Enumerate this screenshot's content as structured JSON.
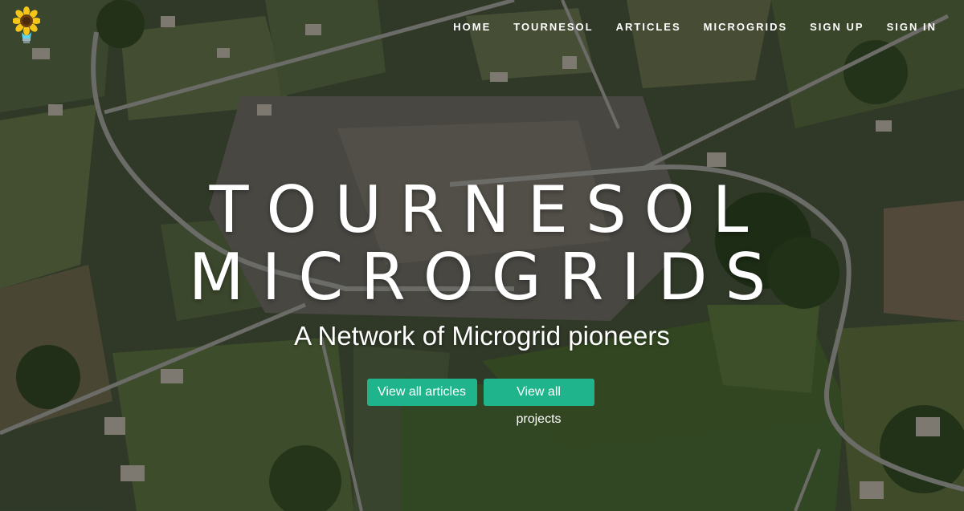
{
  "nav": {
    "items": [
      {
        "label": "HOME"
      },
      {
        "label": "TOURNESOL"
      },
      {
        "label": "ARTICLES"
      },
      {
        "label": "MICROGRIDS"
      },
      {
        "label": "SIGN UP"
      },
      {
        "label": "SIGN IN"
      }
    ]
  },
  "logo": {
    "icon": "sunflower-bulb-icon"
  },
  "hero": {
    "title_line1": "TOURNESOL",
    "title_line2": "MICROGRIDS",
    "subtitle": "A Network of Microgrid pioneers",
    "buttons": {
      "articles": "View all articles",
      "projects": "View all projects"
    },
    "background": "aerial-village-photo"
  },
  "colors": {
    "accent": "#20b48c",
    "text": "#ffffff"
  }
}
